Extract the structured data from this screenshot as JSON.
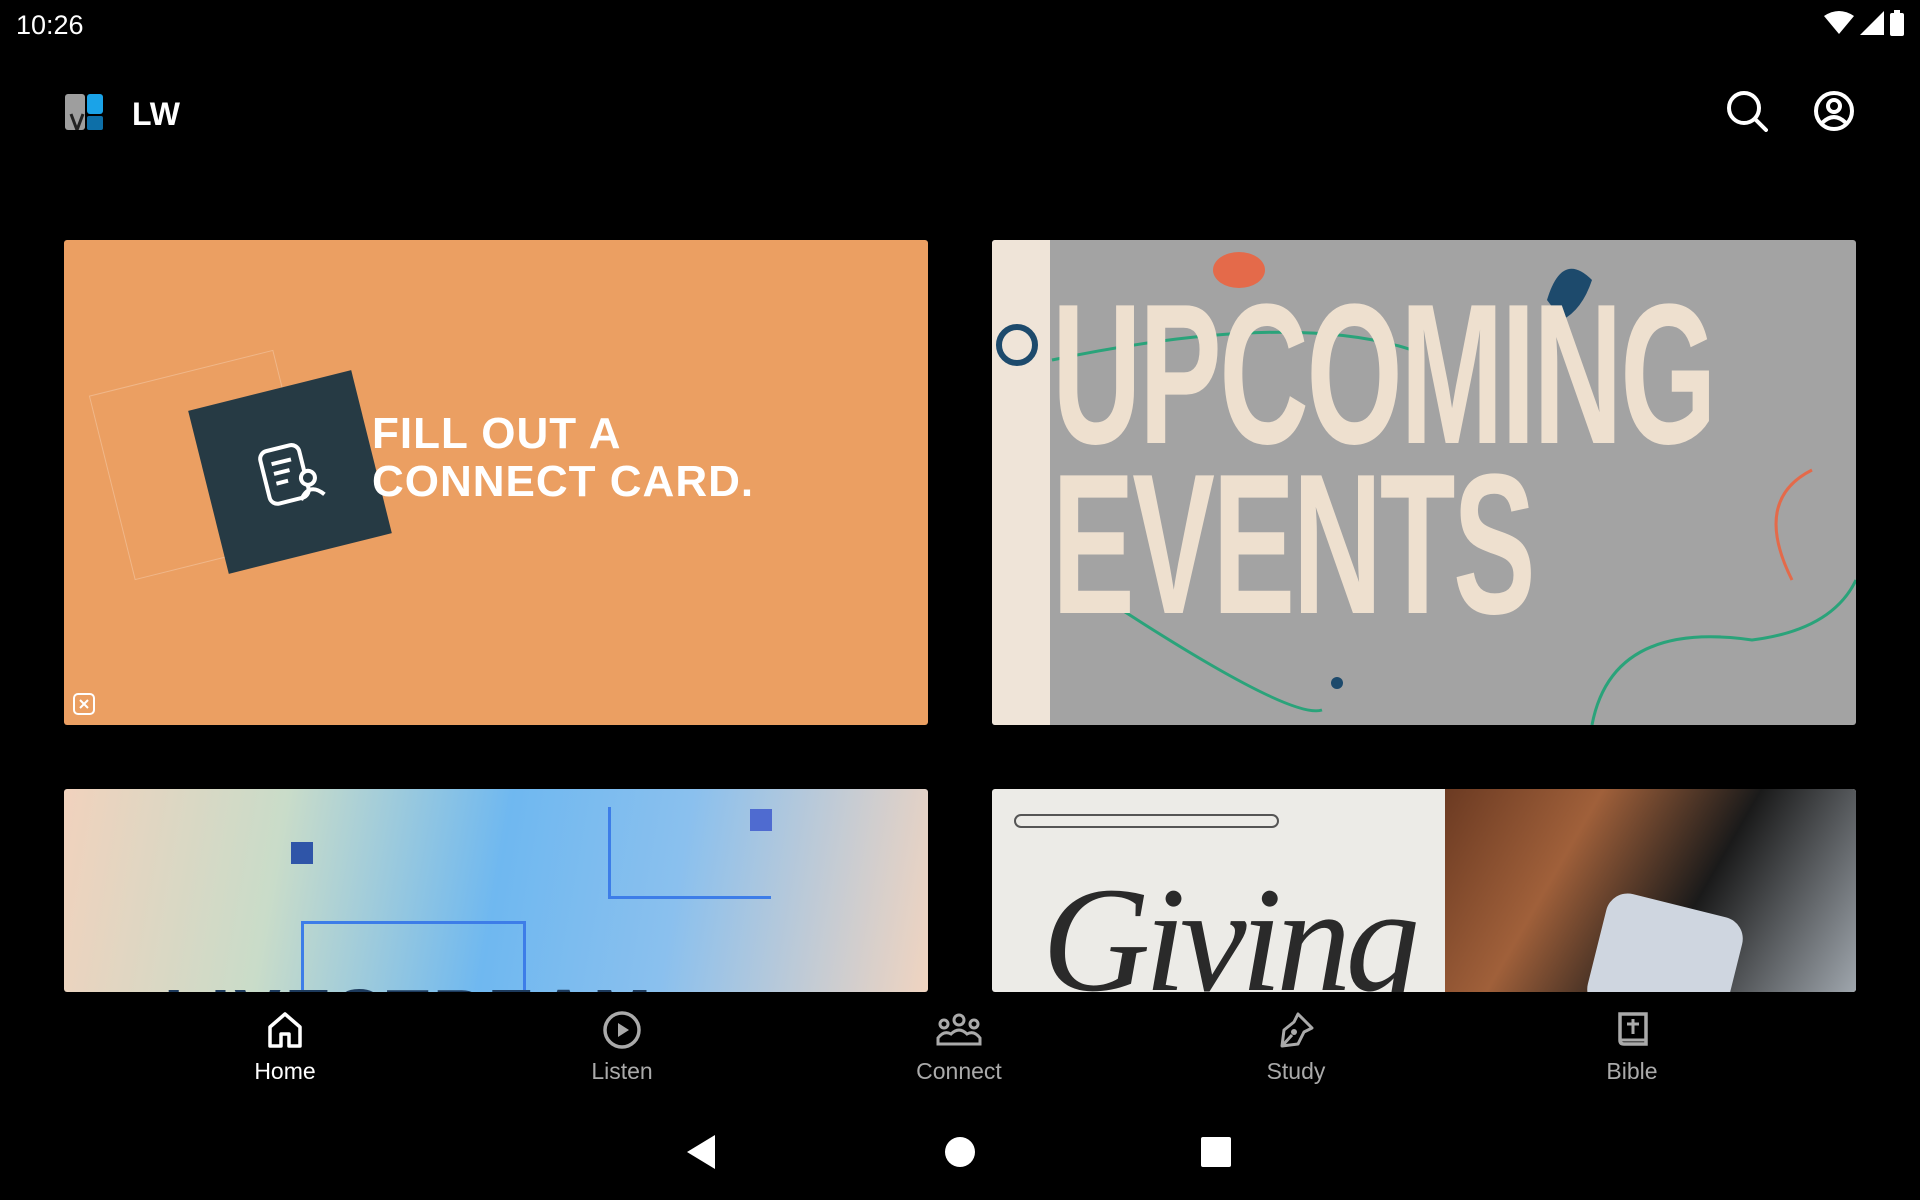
{
  "status_bar": {
    "time": "10:26",
    "icons": [
      "wifi-icon",
      "signal-icon",
      "battery-icon"
    ]
  },
  "header": {
    "title": "LW",
    "logo": "lw-logo",
    "actions": [
      "search-icon",
      "account-circle-icon"
    ]
  },
  "cards": [
    {
      "id": "connect-card",
      "text_line1": "FILL OUT A",
      "text_line2": "CONNECT CARD.",
      "accent": "#eb9f62"
    },
    {
      "id": "upcoming-events",
      "text_line1": "UPCOMING",
      "text_line2": "EVENTS",
      "accent": "#a3a3a3"
    },
    {
      "id": "livestream",
      "text": "LIVESTREAM"
    },
    {
      "id": "giving",
      "text": "Giving"
    }
  ],
  "bottom_nav": {
    "items": [
      {
        "label": "Home",
        "icon": "home-icon",
        "active": true
      },
      {
        "label": "Listen",
        "icon": "play-circle-icon"
      },
      {
        "label": "Connect",
        "icon": "groups-icon"
      },
      {
        "label": "Study",
        "icon": "pen-icon"
      },
      {
        "label": "Bible",
        "icon": "bible-icon"
      }
    ]
  },
  "system_nav": [
    "back-icon",
    "home-circle-icon",
    "recents-icon"
  ]
}
